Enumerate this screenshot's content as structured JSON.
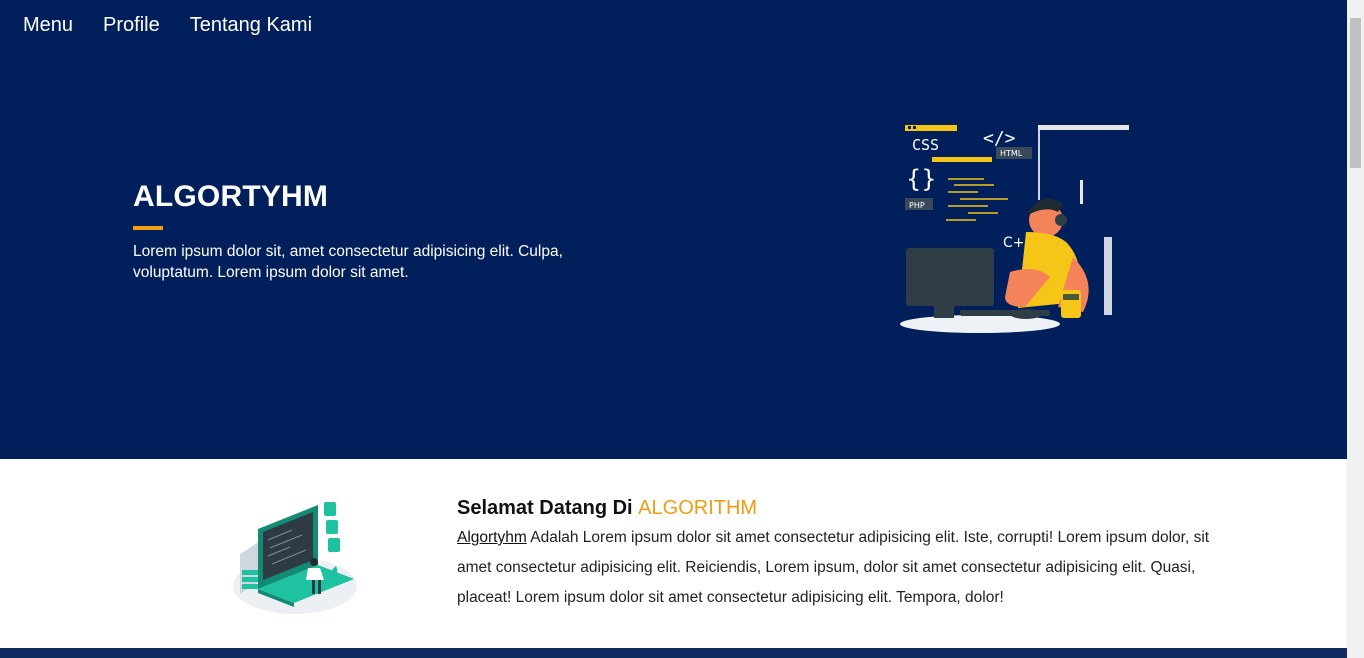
{
  "nav": {
    "items": [
      {
        "label": "Menu"
      },
      {
        "label": "Profile"
      },
      {
        "label": "Tentang Kami"
      }
    ]
  },
  "hero": {
    "title": "ALGORTYHM",
    "text": "Lorem ipsum dolor sit, amet consectetur adipisicing elit. Culpa, voluptatum. Lorem ipsum dolor sit amet.",
    "illustration": {
      "labels": {
        "css": "CSS",
        "html": "HTML",
        "php": "PHP",
        "cpp": "C++"
      }
    }
  },
  "about": {
    "title_prefix": "Selamat Datang Di",
    "title_accent": "ALGORITHM",
    "brand": "Algortyhm",
    "text": "Adalah Lorem ipsum dolor sit amet consectetur adipisicing elit. Iste, corrupti! Lorem ipsum dolor, sit amet consectetur adipisicing elit. Reiciendis, Lorem ipsum, dolor sit amet consectetur adipisicing elit. Quasi, placeat! Lorem ipsum dolor sit amet consectetur adipisicing elit. Tempora, dolor!"
  },
  "colors": {
    "hero_bg": "#011f5b",
    "accent": "#f39c12",
    "white": "#ffffff"
  }
}
